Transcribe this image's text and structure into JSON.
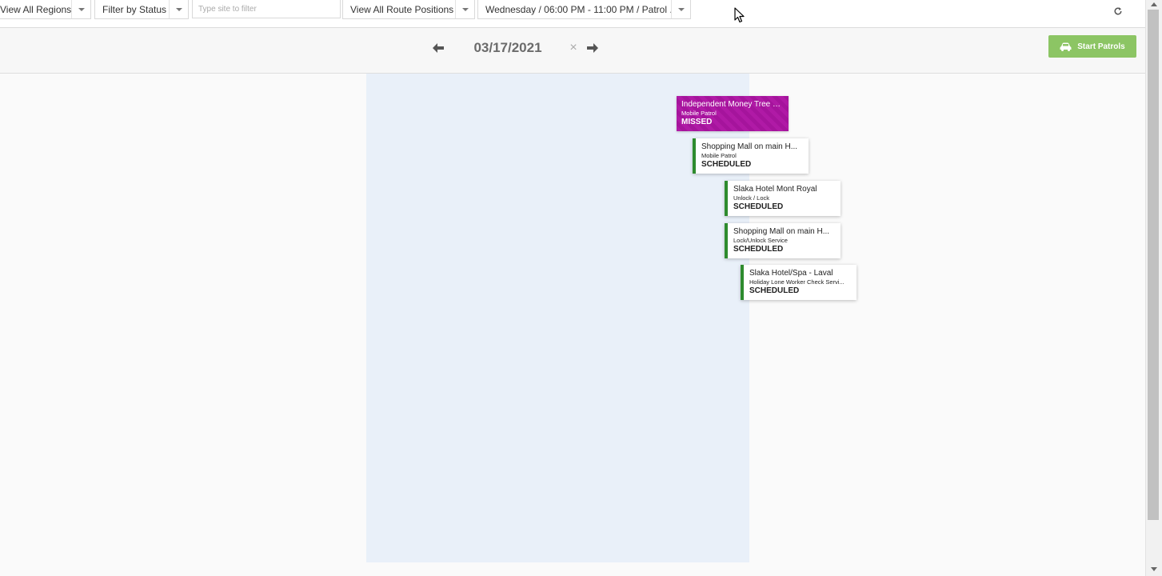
{
  "filters": {
    "regions_label": "View All Regions",
    "status_label": "Filter by Status",
    "site_placeholder": "Type site to filter",
    "route_positions_label": "View All Route Positions",
    "shift_label": "Wednesday / 06:00 PM - 11:00 PM / Patrol ..."
  },
  "date_header": {
    "date": "03/17/2021",
    "clear_symbol": "×",
    "start_button_label": "Start Patrols"
  },
  "colors": {
    "missed": "#b01aa6",
    "scheduled_border": "#2e8b2e",
    "start_button": "#8cc564",
    "timeline_column": "#e9f0f9"
  },
  "patrols": [
    {
      "site": "Independent Money Tree B...",
      "service": "Mobile Patrol",
      "status": "MISSED"
    },
    {
      "site": "Shopping Mall on main H...",
      "service": "Mobile Patrol",
      "status": "SCHEDULED"
    },
    {
      "site": "Slaka Hotel Mont Royal",
      "service": "Unlock / Lock",
      "status": "SCHEDULED"
    },
    {
      "site": "Shopping Mall on main H...",
      "service": "Lock/Unlock Service",
      "status": "SCHEDULED"
    },
    {
      "site": "Slaka Hotel/Spa - Laval",
      "service": "Holiday Lone Worker Check Servi...",
      "status": "SCHEDULED"
    }
  ],
  "icons": {
    "refresh": "refresh-icon",
    "prev": "arrow-left-icon",
    "next": "arrow-right-icon",
    "car": "car-icon"
  }
}
